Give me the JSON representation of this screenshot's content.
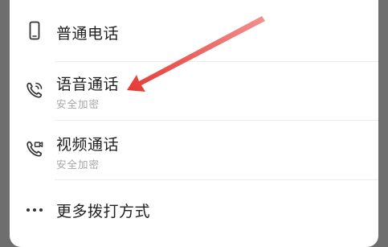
{
  "menu": {
    "items": [
      {
        "title": "普通电话",
        "subtitle": "",
        "icon": "phone-icon"
      },
      {
        "title": "语音通话",
        "subtitle": "安全加密",
        "icon": "voice-call-icon"
      },
      {
        "title": "视频通话",
        "subtitle": "安全加密",
        "icon": "video-call-icon"
      },
      {
        "title": "更多拨打方式",
        "subtitle": "",
        "icon": "more-dots-icon"
      }
    ]
  },
  "colors": {
    "annotation_arrow": "#e53935",
    "icon": "#333333",
    "subtitle": "#a6a6a6"
  }
}
